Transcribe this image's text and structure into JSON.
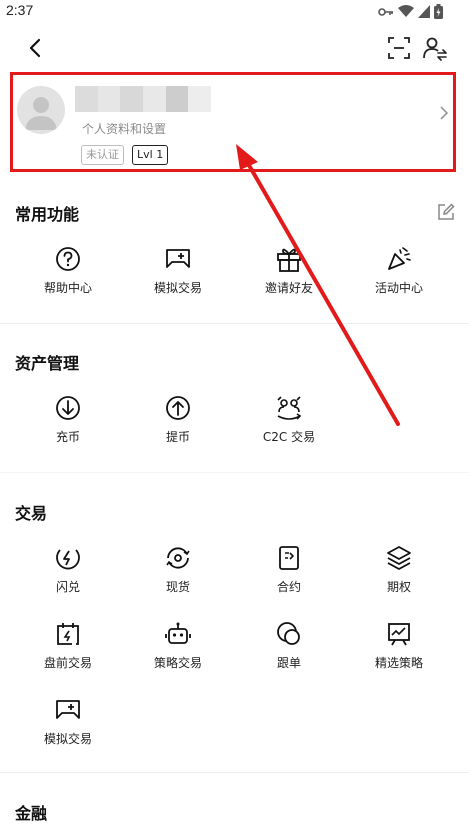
{
  "status_bar": {
    "time": "2:37"
  },
  "profile": {
    "subtitle": "个人资料和设置",
    "badge_unverified": "未认证",
    "badge_level": "Lvl 1"
  },
  "sections": {
    "common": {
      "title": "常用功能",
      "items": [
        "帮助中心",
        "模拟交易",
        "邀请好友",
        "活动中心"
      ]
    },
    "assets": {
      "title": "资产管理",
      "items": [
        "充币",
        "提币",
        "C2C 交易"
      ]
    },
    "trade": {
      "title": "交易",
      "items": [
        "闪兑",
        "现货",
        "合约",
        "期权",
        "盘前交易",
        "策略交易",
        "跟单",
        "精选策略",
        "模拟交易"
      ]
    },
    "finance": {
      "title": "金融"
    }
  },
  "icons": {
    "back": "back-arrow-icon",
    "scan": "scan-icon",
    "account": "switch-account-icon",
    "edit": "edit-icon"
  },
  "colors": {
    "annotation": "#e21a1a",
    "text": "#111111",
    "muted": "#8a8a8a"
  }
}
